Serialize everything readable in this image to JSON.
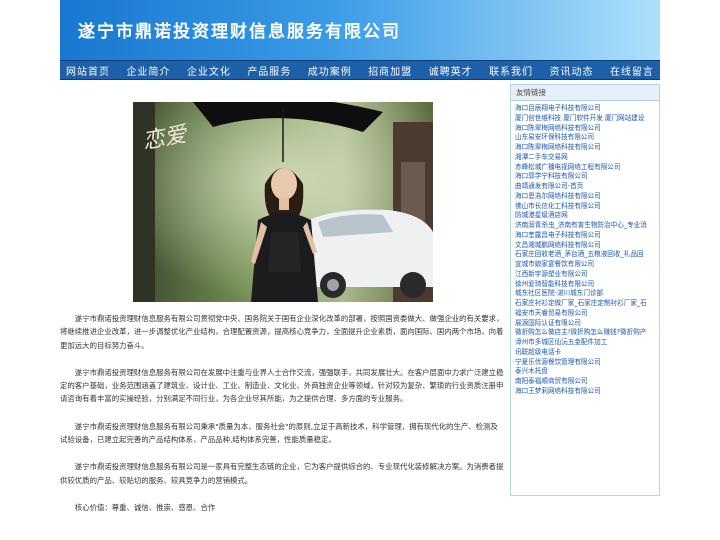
{
  "header": {
    "title": "遂宁市鼎诺投资理财信息服务有限公司",
    "colors": {
      "gradient_start": "#1877d0",
      "gradient_end": "#aee0fb"
    }
  },
  "nav": {
    "items": [
      {
        "label": "网站首页"
      },
      {
        "label": "企业简介"
      },
      {
        "label": "企业文化"
      },
      {
        "label": "产品服务"
      },
      {
        "label": "成功案例"
      },
      {
        "label": "招商加盟"
      },
      {
        "label": "诚聘英才"
      },
      {
        "label": "联系我们"
      },
      {
        "label": "资讯动态"
      },
      {
        "label": "在线留言"
      }
    ],
    "color": "#1d5fa8"
  },
  "hero": {
    "overlay_text": "恋爱"
  },
  "content": {
    "paragraphs": [
      "遂宁市鼎诺投资理财信息服务有限公司贯彻党中央、国务院关于国有企业深化改革的部署，按照国资委做大、做强企业的有关要求，将继续推进企业改革，进一步调整优化产业结构，合理配置资源，提高核心竞争力，全面提升企业素质，面向国际、国内两个市场，向着更加远大的目标努力奋斗。",
      "遂宁市鼎诺投资理财信息服务有限公司在发展中注重与业界人士合作交流，强强联手，共同发展壮大。在客户层面中力求广泛建立稳定的客户基础，业务范围涵盖了建筑业、设计业、工业、制造业、文化业、外商独资企业等领域，针对较为复杂、繁琐的行业资质注册申请咨询有着丰富的实操经验，分别满足不同行业，为各企业尽其所能，为之提供合理、多方面的专业服务。",
      "遂宁市鼎诺投资理财信息服务有限公司秉承\"质量为本，服务社会\"的原则,立足于高新技术，科学管理，拥有现代化的生产、检测及试验设备，已建立起完善的产品结构体系，产品品种,结构体系完善，性能质量稳定。",
      "遂宁市鼎诺投资理财信息服务有限公司是一家具有完整生态链的企业，它为客户提供综合的、专业现代化装修解决方案。为消费者提供较优质的产品、较贴切的服务、较具竞争力的营销模式。",
      "核心价值：尊重、诚信、推崇、感恩、合作"
    ]
  },
  "sidebar": {
    "title": "友情链接",
    "links": [
      "海口目辰翔电子科技有限公司",
      "厦门创世维科技 厦门软件开发 厦门网站建设",
      "海口陈翠梅网络科技有限公司",
      "山东易安环保科技有限公司",
      "海口陈翠梅网络科技有限公司",
      "湘潭二手车交易网",
      "赤峰松城广播电视网络工程有限公司",
      "海口郭学宁科技有限公司",
      "曲靖通发有限公司-首页",
      "海口恩浩尔网络科技有限公司",
      "佛山市长信化工科技有限公司",
      "防城港星级酒店网",
      "济南润青杀虫_济南有害生物防治中心_专业消",
      "海口奎露昌电子科技有限公司",
      "文昌湘城鹏网络科技有限公司",
      "石家庄回收老酒_茅台酒_五粮液回收_礼品回",
      "宣城市娘家宴餐饮有限公司",
      "江西新宇源塑业有限公司",
      "徐州爱琦智能科技有限公司",
      "城东社区医院-湛川城东门诊部",
      "石家庄衬衫定做厂家_石家庄定制衬衫厂家_石",
      "福安市天睿贸易有限公司",
      "展源国际认证有限公司",
      "微折购怎么做店主!微折购怎么赚钱?微折购产",
      "漳州市多城区仙沅五金配件加工",
      "讯联超级电话卡",
      "宁夏乐优源餐饮管理有限公司",
      "泰兴木托盘",
      "南阳泰福顺商贸有限公司",
      "海口王梦莉网络科技有限公司"
    ]
  }
}
